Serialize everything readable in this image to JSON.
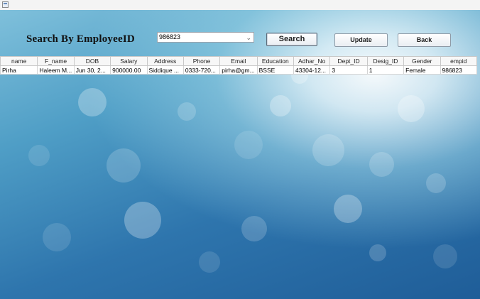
{
  "search": {
    "label": "Search By EmployeeID",
    "selected_id": "986823",
    "button_label": "Search"
  },
  "actions": {
    "update_label": "Update",
    "back_label": "Back"
  },
  "table": {
    "columns": [
      "name",
      "F_name",
      "DOB",
      "Salary",
      "Address",
      "Phone",
      "Email",
      "Education",
      "Adhar_No",
      "Dept_ID",
      "Desig_ID",
      "Gender",
      "empid"
    ],
    "rows": [
      [
        "Pirha",
        "Haleem M...",
        "Jun 30, 2...",
        "900000.00",
        "Siddique ...",
        "0333-720...",
        "pirha@gm...",
        "BSSE",
        "43304-12...",
        "3",
        "1",
        "Female",
        "986823"
      ]
    ]
  }
}
